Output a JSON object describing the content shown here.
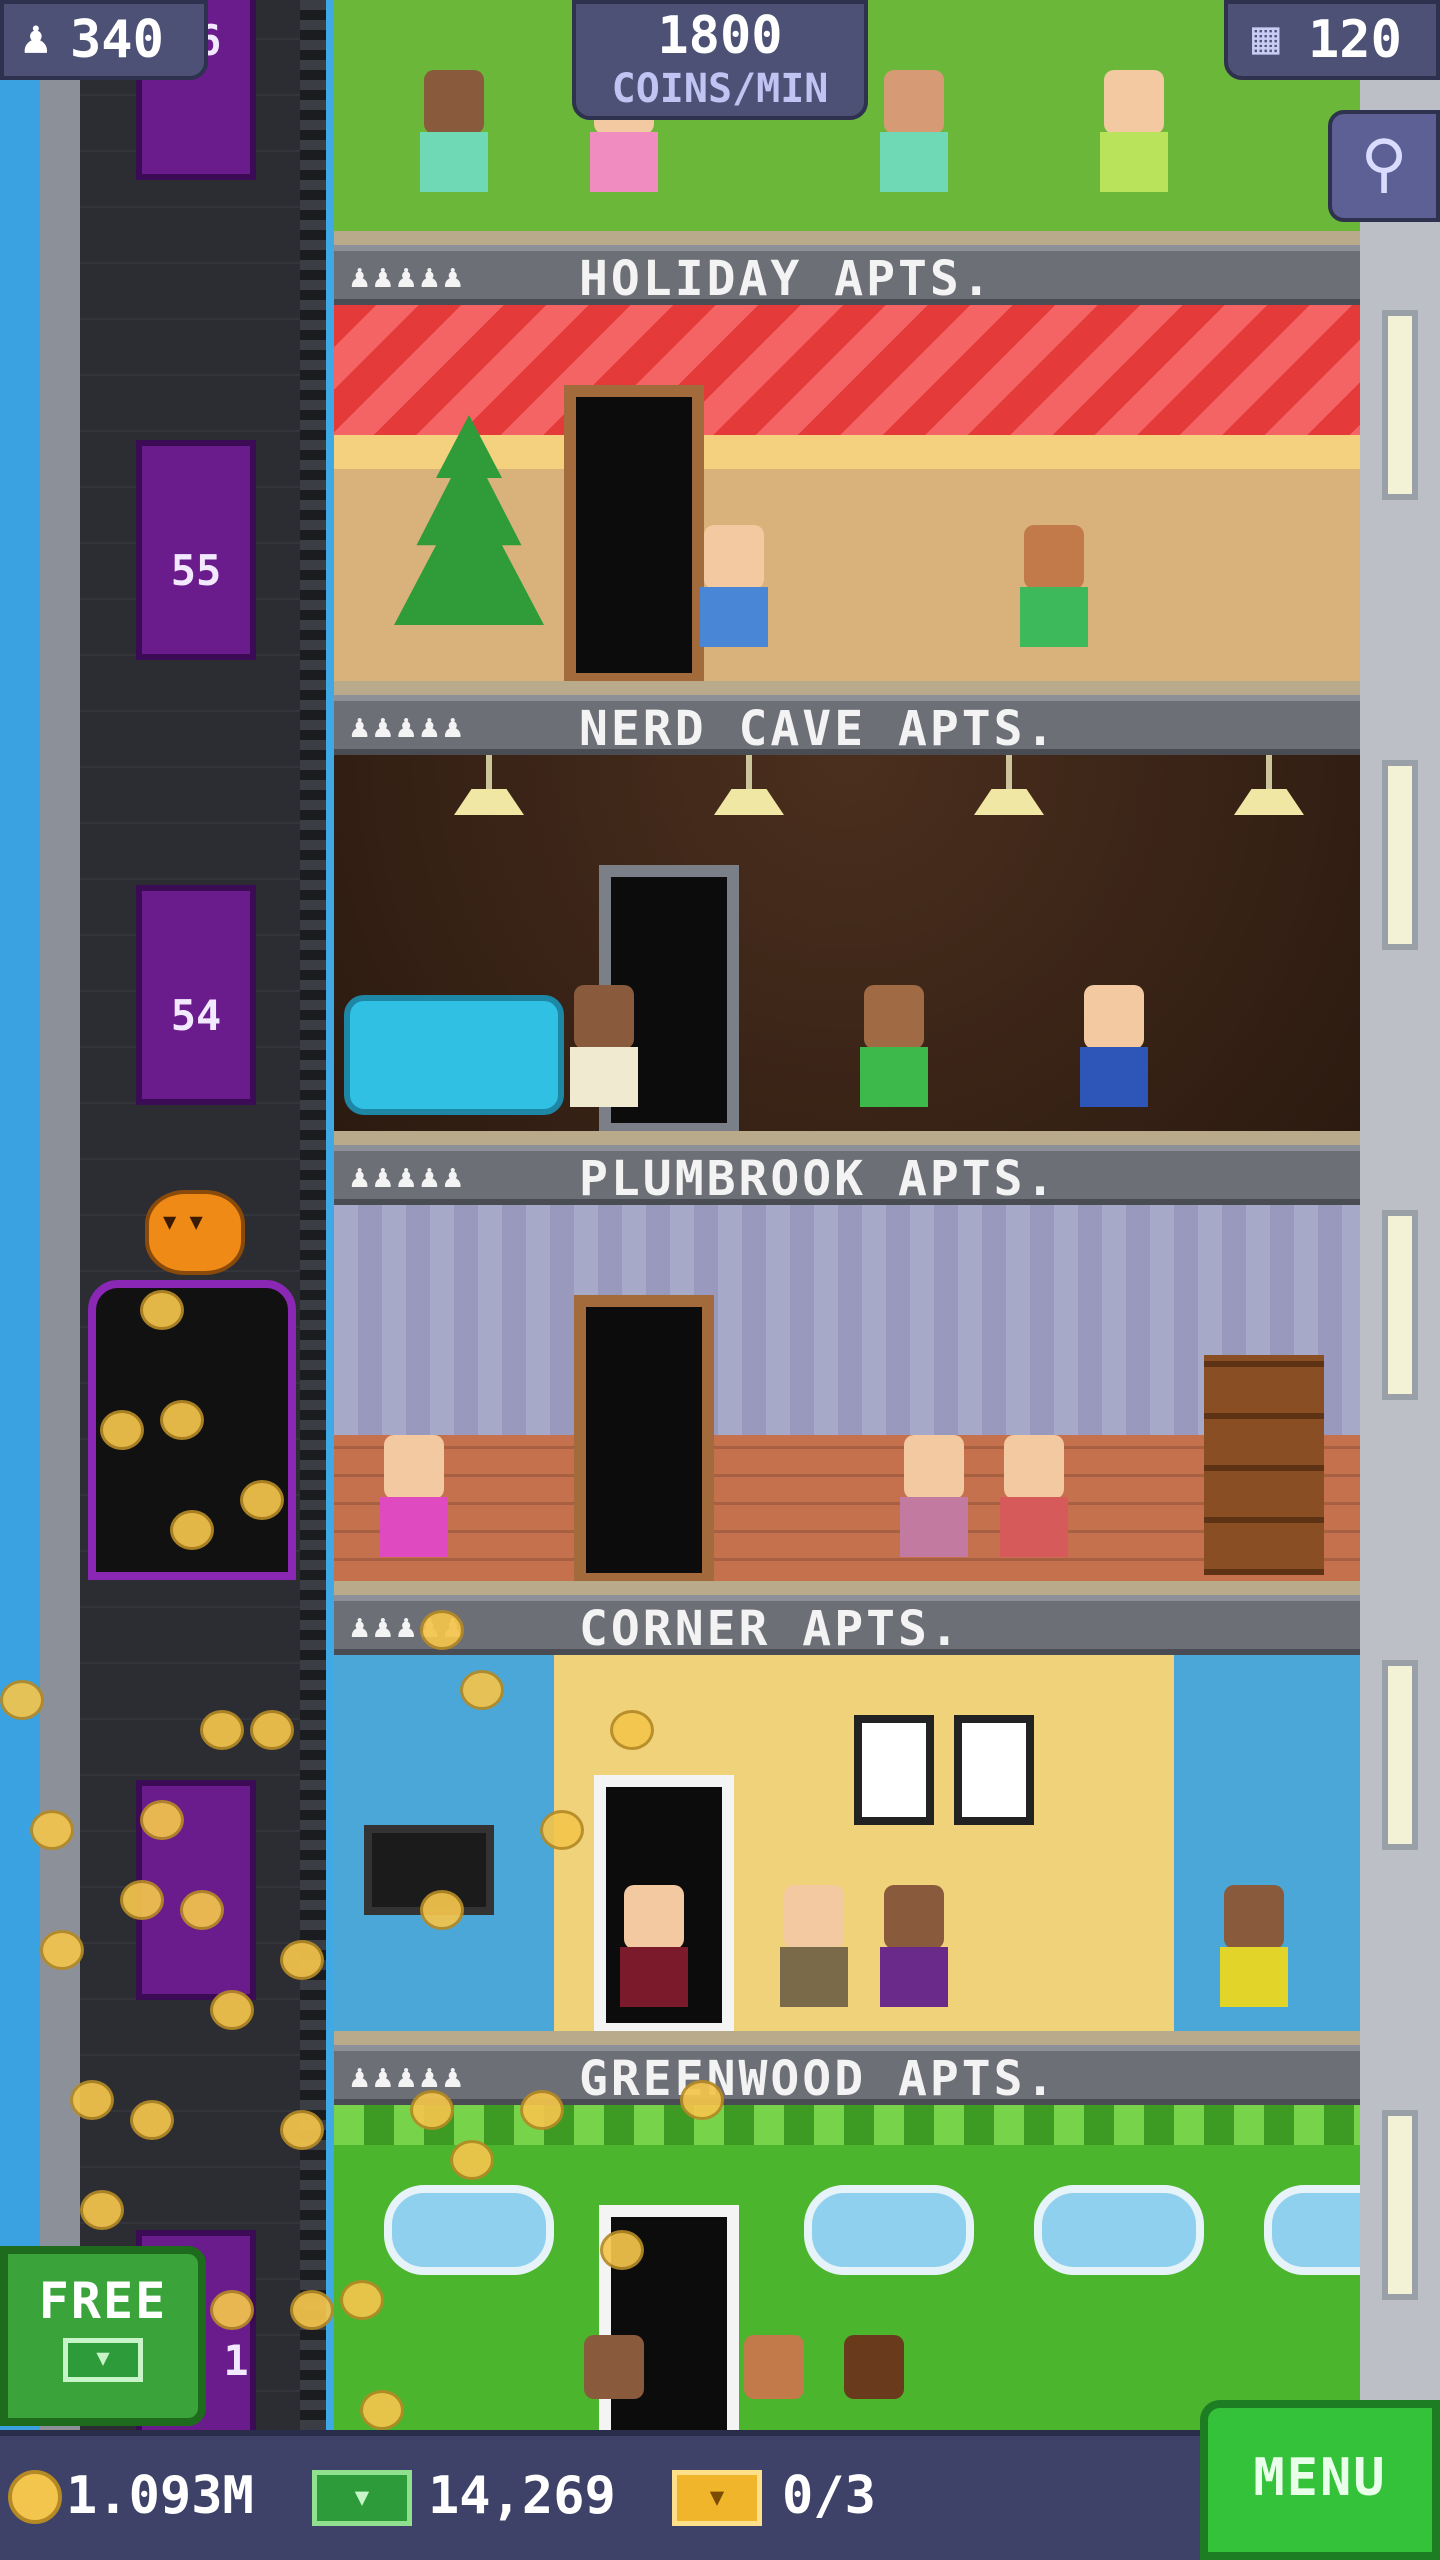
{
  "hud": {
    "population": "340",
    "coins_per_min_value": "1800",
    "coins_per_min_label": "COINS/MIN",
    "floors": "120"
  },
  "elevator": {
    "floor_numbers": [
      "56",
      "55",
      "54",
      "1"
    ]
  },
  "floors": [
    {
      "name": "HOLIDAY APTS.",
      "residents": "♟♟♟♟♟"
    },
    {
      "name": "NERD CAVE APTS.",
      "residents": "♟♟♟♟♟"
    },
    {
      "name": "PLUMBROOK APTS.",
      "residents": "♟♟♟♟♟"
    },
    {
      "name": "CORNER APTS.",
      "residents": "♟♟♟♟♟"
    },
    {
      "name": "GREENWOOD APTS.",
      "residents": "♟♟♟♟♟"
    }
  ],
  "free_button": {
    "label": "FREE"
  },
  "bottom_bar": {
    "coins": "1.093M",
    "bux": "14,269",
    "vip": "0/3",
    "menu_label": "MENU"
  },
  "icons": [
    "population-icon",
    "floors-icon",
    "search-icon",
    "coin-icon",
    "bux-icon",
    "vip-ticket-icon",
    "bat-icon",
    "pumpkin-icon"
  ],
  "colors": {
    "hud_bg": "#4d5175",
    "menu_green": "#34c23a",
    "elevator_purple": "#6a1b8c",
    "coin_gold": "#f4c54c"
  }
}
